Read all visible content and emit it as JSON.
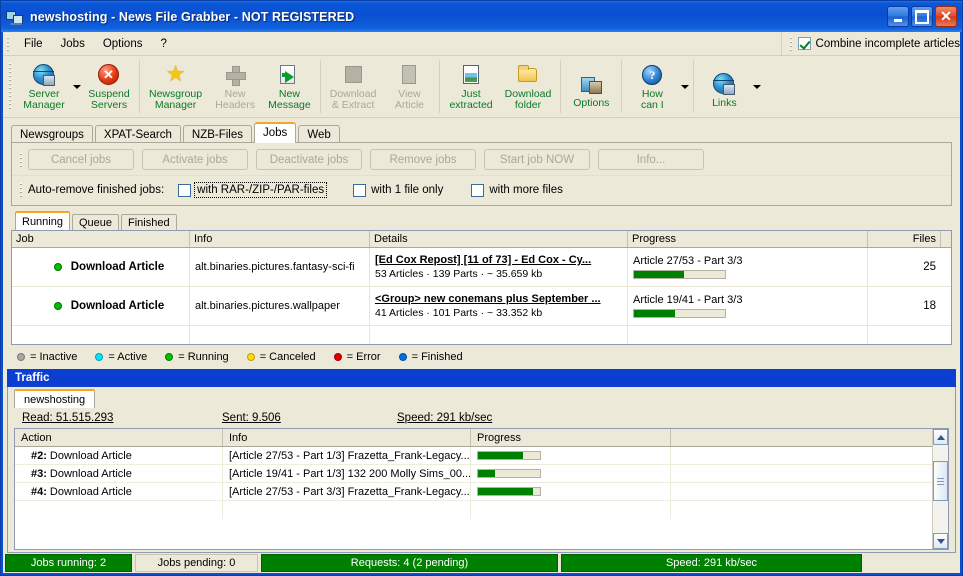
{
  "window": {
    "title": "newshosting - News File Grabber - NOT REGISTERED",
    "icon": "computers-icon",
    "buttons": {
      "minimize": "_",
      "maximize": "□",
      "close": "✕"
    }
  },
  "menu": {
    "items": [
      "File",
      "Jobs",
      "Options",
      "?"
    ],
    "combine_checkbox": {
      "label": "Combine incomplete articles",
      "checked": true
    }
  },
  "toolbar": {
    "groups": [
      {
        "items": [
          {
            "label": "Server\nManager",
            "icon": "globe-icon",
            "enabled": true,
            "has_dropdown": true
          },
          {
            "label": "Suspend\nServers",
            "icon": "red-x-icon",
            "enabled": true,
            "has_dropdown": false
          }
        ]
      },
      {
        "items": [
          {
            "label": "Newsgroup\nManager",
            "icon": "star-icon",
            "enabled": true,
            "has_dropdown": false
          },
          {
            "label": "New\nHeaders",
            "icon": "plus-icon",
            "enabled": false,
            "has_dropdown": false
          },
          {
            "label": "New\nMessage",
            "icon": "new-message-icon",
            "enabled": true,
            "has_dropdown": false
          }
        ]
      },
      {
        "items": [
          {
            "label": "Download\n& Extract",
            "icon": "download-extract-icon",
            "enabled": false,
            "has_dropdown": false
          },
          {
            "label": "View\nArticle",
            "icon": "view-article-icon",
            "enabled": false,
            "has_dropdown": false
          }
        ]
      },
      {
        "items": [
          {
            "label": "Just\nextracted",
            "icon": "image-doc-icon",
            "enabled": true,
            "has_dropdown": false
          },
          {
            "label": "Download\nfolder",
            "icon": "folder-icon",
            "enabled": true,
            "has_dropdown": false
          }
        ]
      },
      {
        "items": [
          {
            "label": "Options",
            "icon": "options-icon",
            "enabled": true,
            "has_dropdown": false
          }
        ]
      },
      {
        "items": [
          {
            "label": "How\ncan I",
            "icon": "help-icon",
            "enabled": true,
            "has_dropdown": true
          }
        ]
      },
      {
        "items": [
          {
            "label": "Links",
            "icon": "globe-icon",
            "enabled": true,
            "has_dropdown": true
          }
        ]
      }
    ]
  },
  "tabs": {
    "items": [
      "Newsgroups",
      "XPAT-Search",
      "NZB-Files",
      "Jobs",
      "Web"
    ],
    "active": "Jobs"
  },
  "jobs_panel": {
    "buttons": [
      "Cancel jobs",
      "Activate jobs",
      "Deactivate jobs",
      "Remove jobs",
      "Start job NOW",
      "Info..."
    ],
    "autoremove": {
      "label": "Auto-remove finished jobs:",
      "options": [
        {
          "label": "with RAR-/ZIP-/PAR-files",
          "checked": false,
          "focused": true
        },
        {
          "label": "with 1 file only",
          "checked": false,
          "focused": false
        },
        {
          "label": "with more files",
          "checked": false,
          "focused": false
        }
      ]
    },
    "subtabs": {
      "items": [
        "Running",
        "Queue",
        "Finished"
      ],
      "active": "Running"
    },
    "table": {
      "columns": [
        "Job",
        "Info",
        "Details",
        "Progress",
        "Files"
      ],
      "rows": [
        {
          "status": "running",
          "job": "Download Article",
          "info": "alt.binaries.pictures.fantasy-sci-fi",
          "details_title": "[Ed Cox Repost] [11 of 73] - Ed Cox - Cy...",
          "details_sub": "53 Articles · 139 Parts · ~ 35.659 kb",
          "progress_label": "Article 27/53 - Part 3/3",
          "progress_percent": 55,
          "files": "25"
        },
        {
          "status": "running",
          "job": "Download Article",
          "info": "alt.binaries.pictures.wallpaper",
          "details_title": "<Group> new conemans plus September ...",
          "details_sub": "41 Articles · 101 Parts · ~ 33.352 kb",
          "progress_label": "Article 19/41 - Part 3/3",
          "progress_percent": 45,
          "files": "18"
        }
      ]
    },
    "legend": [
      {
        "label": "= Inactive",
        "color": "#a8a8a8"
      },
      {
        "label": "= Active",
        "color": "#00e5ff"
      },
      {
        "label": "= Running",
        "color": "#00c000"
      },
      {
        "label": "= Canceled",
        "color": "#ffd800"
      },
      {
        "label": "= Error",
        "color": "#e00000"
      },
      {
        "label": "= Finished",
        "color": "#0070e0"
      }
    ]
  },
  "traffic": {
    "title": "Traffic",
    "tabs": {
      "items": [
        "newshosting"
      ],
      "active": "newshosting"
    },
    "stats": [
      {
        "label": "Read: 51.515.293"
      },
      {
        "label": "Sent: 9.506"
      },
      {
        "label": "Speed: 291 kb/sec"
      }
    ],
    "table": {
      "columns": [
        "Action",
        "Info",
        "Progress",
        ""
      ],
      "rows": [
        {
          "num": "#2:",
          "action": "Download Article",
          "info": "[Article 27/53 - Part 1/3] Frazetta_Frank-Legacy...",
          "progress_percent": 72
        },
        {
          "num": "#3:",
          "action": "Download Article",
          "info": "[Article 19/41 - Part 1/3] 132 200 Molly Sims_00...",
          "progress_percent": 28
        },
        {
          "num": "#4:",
          "action": "Download Article",
          "info": "[Article 27/53 - Part 3/3] Frazetta_Frank-Legacy...",
          "progress_percent": 88
        }
      ]
    }
  },
  "statusbar": {
    "panels": [
      {
        "text": "Jobs running: 2",
        "style": "green"
      },
      {
        "text": "Jobs pending: 0",
        "style": "plain"
      },
      {
        "text": "Requests: 4 (2 pending)",
        "style": "green"
      },
      {
        "text": "Speed: 291 kb/sec",
        "style": "green"
      }
    ]
  },
  "colors": {
    "title_blue": "#0a4fd1",
    "progress_green": "#008000",
    "tab_accent": "#f5a623",
    "toolbar_label_green": "#0a7a28"
  }
}
